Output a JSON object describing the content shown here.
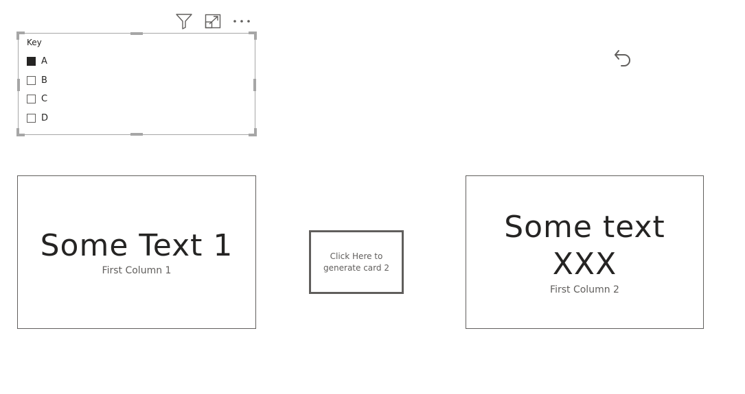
{
  "visual_header": {
    "filter_icon": "filter-icon",
    "focus_icon": "focus-mode-icon",
    "more_icon": "more-options-icon"
  },
  "slicer": {
    "title": "Key",
    "items": [
      {
        "label": "A",
        "checked": true
      },
      {
        "label": "B",
        "checked": false
      },
      {
        "label": "C",
        "checked": false
      },
      {
        "label": "D",
        "checked": false
      }
    ]
  },
  "back_button": {
    "icon": "back-arrow-icon"
  },
  "card_1": {
    "value": "Some Text 1",
    "label": "First Column 1"
  },
  "generate_button": {
    "label": "Click Here to generate card 2"
  },
  "card_2": {
    "value": "Some text XXX",
    "label": "First Column 2"
  },
  "colors": {
    "text": "#252423",
    "secondary_text": "#605e5c",
    "border": "#605e5c",
    "selection_border": "#a6a6a6"
  }
}
